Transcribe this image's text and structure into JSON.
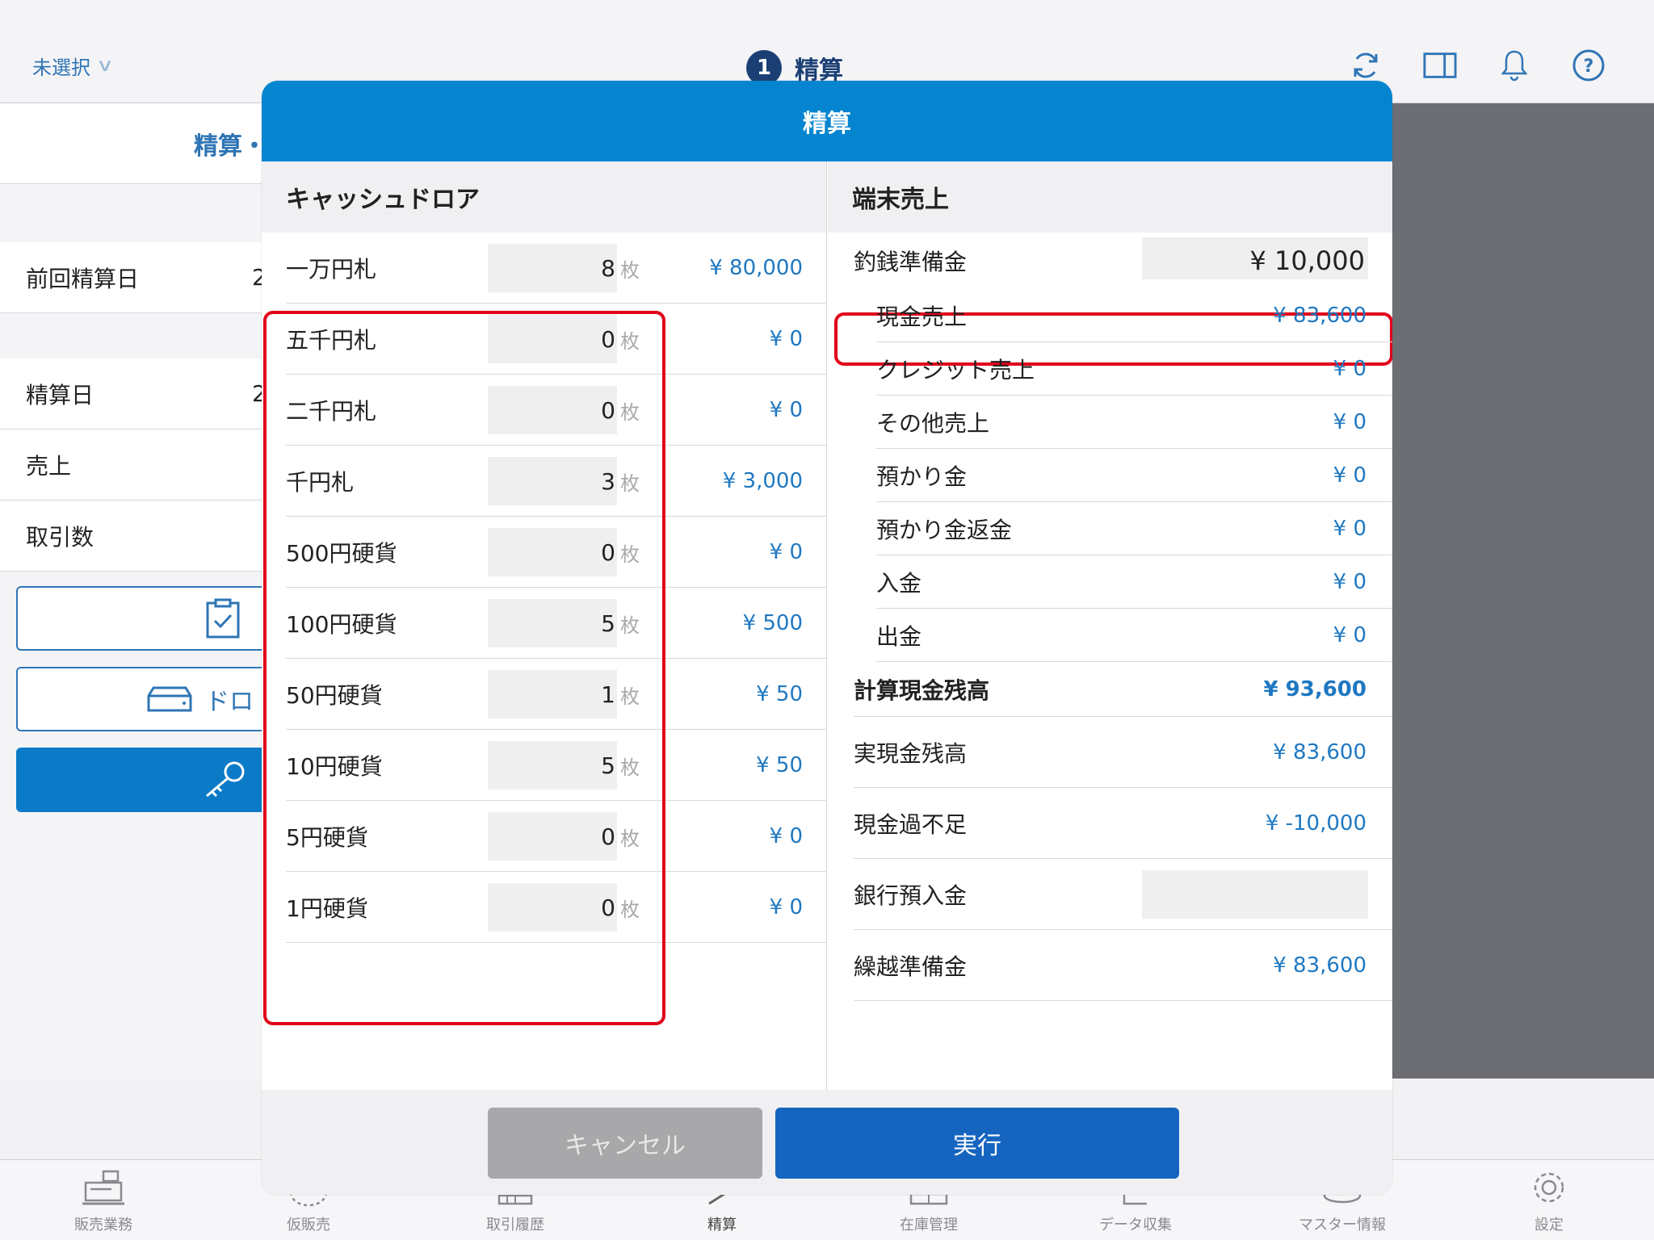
{
  "header": {
    "store_select": "未選択",
    "badge_number": "1",
    "title": "精算"
  },
  "left_pane": {
    "header_fragment": "精算・",
    "rows": [
      {
        "label": "前回精算日",
        "value": "2"
      },
      {
        "label": "精算日",
        "value": "2"
      },
      {
        "label": "売上",
        "value": ""
      },
      {
        "label": "取引数",
        "value": ""
      }
    ],
    "drawer_button_fragment": "ドロ"
  },
  "modal": {
    "title": "精算",
    "cash_drawer": {
      "heading": "キャッシュドロア",
      "unit": "枚",
      "rows": [
        {
          "label": "一万円札",
          "qty": "8",
          "amount": "¥ 80,000"
        },
        {
          "label": "五千円札",
          "qty": "0",
          "amount": "¥ 0"
        },
        {
          "label": "二千円札",
          "qty": "0",
          "amount": "¥ 0"
        },
        {
          "label": "千円札",
          "qty": "3",
          "amount": "¥ 3,000"
        },
        {
          "label": "500円硬貨",
          "qty": "0",
          "amount": "¥ 0"
        },
        {
          "label": "100円硬貨",
          "qty": "5",
          "amount": "¥ 500"
        },
        {
          "label": "50円硬貨",
          "qty": "1",
          "amount": "¥ 50"
        },
        {
          "label": "10円硬貨",
          "qty": "5",
          "amount": "¥ 50"
        },
        {
          "label": "5円硬貨",
          "qty": "0",
          "amount": "¥ 0"
        },
        {
          "label": "1円硬貨",
          "qty": "0",
          "amount": "¥ 0"
        }
      ]
    },
    "terminal_sales": {
      "heading": "端末売上",
      "change_reserve": {
        "label": "釣銭準備金",
        "value": "¥ 10,000"
      },
      "sub_rows": [
        {
          "label": "現金売上",
          "value": "¥ 83,600"
        },
        {
          "label": "クレジット売上",
          "value": "¥ 0"
        },
        {
          "label": "その他売上",
          "value": "¥ 0"
        },
        {
          "label": "預かり金",
          "value": "¥ 0"
        },
        {
          "label": "預かり金返金",
          "value": "¥ 0"
        },
        {
          "label": "入金",
          "value": "¥ 0"
        },
        {
          "label": "出金",
          "value": "¥ 0"
        }
      ],
      "calc_balance": {
        "label": "計算現金残高",
        "value": "¥ 93,600"
      },
      "actual_balance": {
        "label": "実現金残高",
        "value": "¥ 83,600"
      },
      "over_short": {
        "label": "現金過不足",
        "value": "¥ -10,000"
      },
      "bank_deposit": {
        "label": "銀行預入金",
        "value": ""
      },
      "carry_over": {
        "label": "繰越準備金",
        "value": "¥ 83,600"
      }
    },
    "buttons": {
      "cancel": "キャンセル",
      "execute": "実行"
    }
  },
  "tabs": [
    {
      "label": "販売業務",
      "icon": "register-icon"
    },
    {
      "label": "仮販売",
      "icon": "temp-sale-icon"
    },
    {
      "label": "取引履歴",
      "icon": "history-icon"
    },
    {
      "label": "精算",
      "icon": "settlement-icon"
    },
    {
      "label": "在庫管理",
      "icon": "inventory-icon"
    },
    {
      "label": "データ収集",
      "icon": "data-collect-icon"
    },
    {
      "label": "マスター情報",
      "icon": "master-icon"
    },
    {
      "label": "設定",
      "icon": "gear-icon"
    }
  ],
  "colors": {
    "modal_header": "#0585d0",
    "accent_text": "#1f78c1",
    "highlight_border": "#e0001a",
    "execute_button": "#1565c0",
    "cancel_button": "#a8a8aa"
  }
}
